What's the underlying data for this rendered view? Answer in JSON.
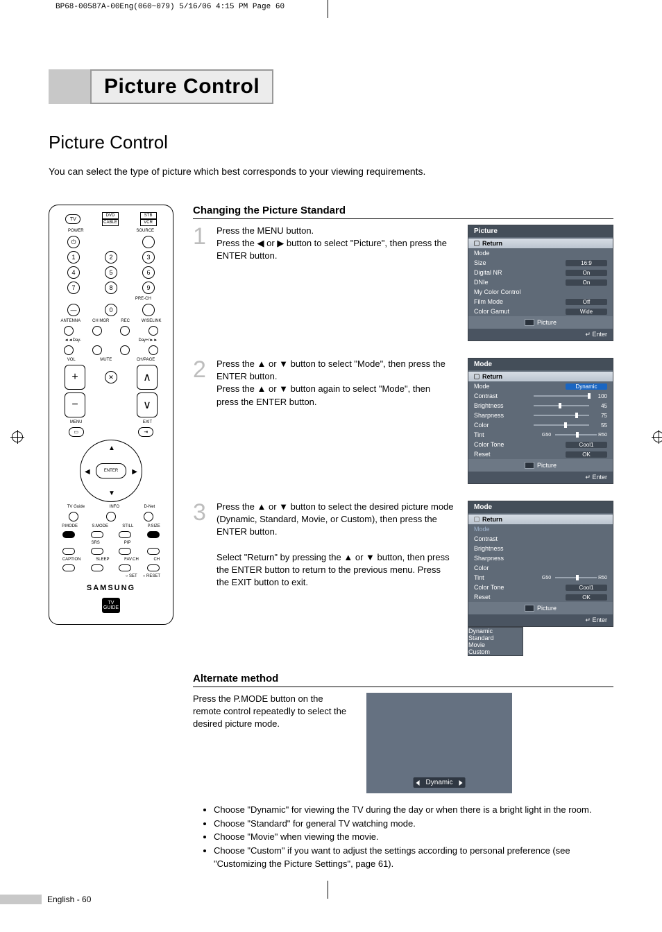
{
  "crop_header": "BP68-00587A-00Eng(060~079)  5/16/06  4:15 PM  Page 60",
  "banner_title": "Picture Control",
  "subtitle": "Picture Control",
  "intro": "You can select the type of picture which best corresponds to your viewing requirements.",
  "remote": {
    "tv": "TV",
    "dvd": "DVD",
    "stb": "STB",
    "cable": "CABLE",
    "vcr": "VCR",
    "power": "POWER",
    "source": "SOURCE",
    "nums": [
      "1",
      "2",
      "3",
      "4",
      "5",
      "6",
      "7",
      "8",
      "9",
      "0"
    ],
    "pre_ch": "PRE-CH",
    "antenna": "ANTENNA",
    "chmgr": "CH MGR",
    "rec": "REC",
    "wiselink": "WISELINK",
    "day_minus": "◄◄Day-",
    "day_plus": "Day+/►►",
    "vol": "VOL",
    "chpage": "CH/PAGE",
    "mute": "MUTE",
    "menu": "MENU",
    "exit": "EXIT",
    "enter": "ENTER",
    "tvguide_lbl": "TV Guide",
    "info": "INFO",
    "dnet": "D-Net",
    "row_pm": [
      "P.MODE",
      "S.MODE",
      "STILL",
      "P.SIZE"
    ],
    "row_srs": [
      "SRS",
      "PIP"
    ],
    "row_cap": [
      "CAPTION",
      "SLEEP",
      "FAV.CH",
      "CH"
    ],
    "set": "SET",
    "reset": "RESET",
    "brand": "SAMSUNG",
    "tvguide": "TV GUIDE"
  },
  "section1": "Changing the Picture Standard",
  "step1_num": "1",
  "step1_text": "Press the MENU button.\nPress the ◀ or ▶ button to select \"Picture\", then press the ENTER button.",
  "step2_num": "2",
  "step2_text": "Press the ▲ or ▼ button to select \"Mode\", then press the ENTER button.\nPress the ▲ or ▼ button again to select \"Mode\", then press the ENTER button.",
  "step3_num": "3",
  "step3_text_a": "Press the ▲ or ▼ button to select the desired picture mode (Dynamic, Standard, Movie, or Custom), then press the ENTER button.",
  "step3_text_b": "Select \"Return\" by pressing the ▲ or ▼ button, then press the ENTER button to return to the previous menu. Press the EXIT button to exit.",
  "section2": "Alternate method",
  "alt_text": "Press the P.MODE button on the remote control repeatedly to select the desired picture mode.",
  "alt_label": "Dynamic",
  "bullets": [
    "Choose \"Dynamic\" for viewing the TV during the day or when there is a bright light in the room.",
    "Choose \"Standard\" for general TV watching mode.",
    "Choose \"Movie\" when viewing the movie.",
    "Choose \"Custom\" if you want to adjust the settings according to personal preference (see \"Customizing the Picture Settings\", page 61)."
  ],
  "osd1": {
    "title": "Picture",
    "return": "Return",
    "rows": [
      {
        "k": "Mode",
        "v": ""
      },
      {
        "k": "Size",
        "v": "16:9"
      },
      {
        "k": "Digital NR",
        "v": "On"
      },
      {
        "k": "DNIe",
        "v": "On"
      },
      {
        "k": "My Color Control",
        "v": ""
      },
      {
        "k": "Film Mode",
        "v": "Off"
      },
      {
        "k": "Color Gamut",
        "v": "Wide"
      }
    ],
    "footer": "Picture",
    "enter": "Enter"
  },
  "osd2": {
    "title": "Mode",
    "return": "Return",
    "mode_row": {
      "k": "Mode",
      "v": "Dynamic"
    },
    "sliders": [
      {
        "k": "Contrast",
        "pos": 98,
        "val": "100"
      },
      {
        "k": "Brightness",
        "pos": 45,
        "val": "45"
      },
      {
        "k": "Sharpness",
        "pos": 75,
        "val": "75"
      },
      {
        "k": "Color",
        "pos": 55,
        "val": "55"
      }
    ],
    "tint": {
      "k": "Tint",
      "left": "G50",
      "right": "R50",
      "pos": 50
    },
    "tone": {
      "k": "Color Tone",
      "v": "Cool1"
    },
    "reset": {
      "k": "Reset",
      "v": "OK"
    },
    "footer": "Picture",
    "enter": "Enter"
  },
  "osd3": {
    "title": "Mode",
    "return": "Return",
    "rows_left": [
      "Mode",
      "Contrast",
      "Brightness",
      "Sharpness",
      "Color",
      "Tint",
      "Color Tone",
      "Reset"
    ],
    "tint": {
      "left": "G50",
      "right": "R50"
    },
    "tone_v": "Cool1",
    "reset_v": "OK",
    "popup": [
      "Dynamic",
      "Standard",
      "Movie",
      "Custom"
    ],
    "footer": "Picture",
    "enter": "Enter"
  },
  "page_footer": "English - 60"
}
